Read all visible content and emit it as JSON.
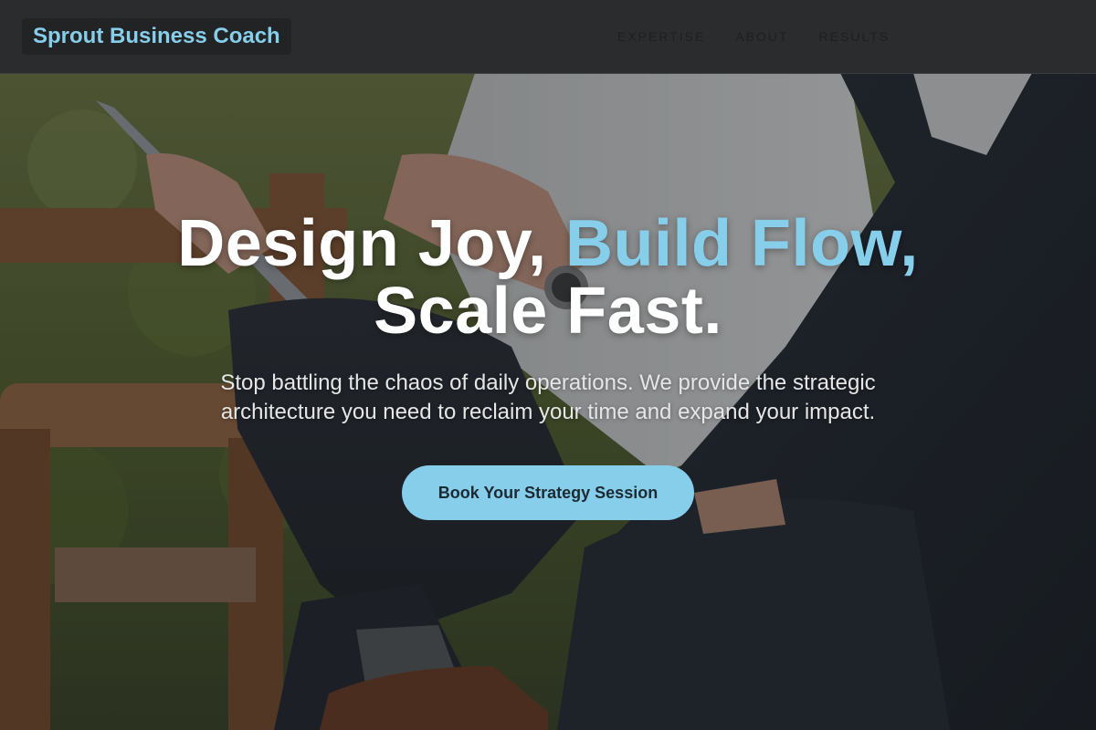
{
  "nav": {
    "brand": "Sprout Business Coach",
    "links": [
      {
        "label": "EXPERTISE"
      },
      {
        "label": "ABOUT"
      },
      {
        "label": "RESULTS"
      }
    ]
  },
  "hero": {
    "title_line1_white": "Design Joy, ",
    "title_line1_accent": "Build Flow,",
    "title_line2": "Scale Fast.",
    "subtitle": "Stop battling the chaos of daily operations. We provide the strategic architecture you need to reclaim your time and expand your impact.",
    "cta_label": "Book Your Strategy Session"
  },
  "colors": {
    "accent": "#87ceeb",
    "nav_background": "#2c2d2f",
    "text_primary": "#ffffff"
  }
}
